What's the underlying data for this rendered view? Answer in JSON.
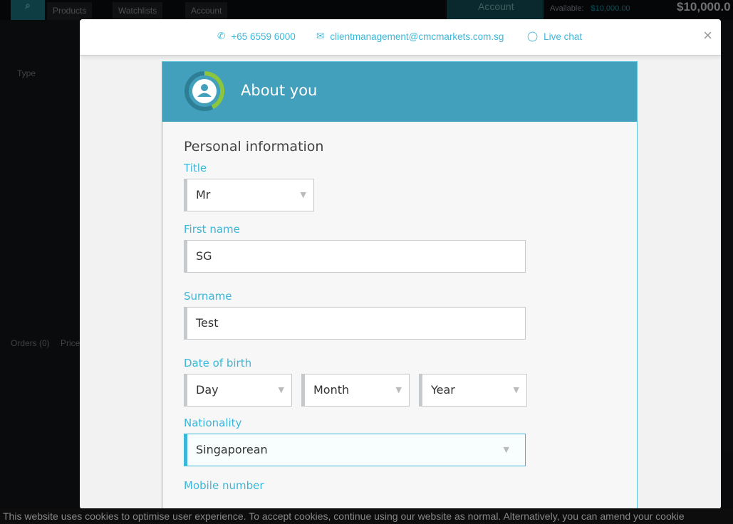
{
  "app": {
    "nav": [
      "Products",
      "Watchlists",
      "Account"
    ],
    "account_label": "Account",
    "available_label": "Available:",
    "available_value": "$10,000.00",
    "balance": "$10,000.0",
    "col_type": "Type",
    "orders_tab": "Orders (0)",
    "prices_tab": "Price"
  },
  "modal": {
    "phone": "+65 6559 6000",
    "email": "clientmanagement@cmcmarkets.com.sg",
    "chat": "Live chat",
    "close": "×"
  },
  "card": {
    "title": "About you",
    "section": "Personal information",
    "title_label": "Title",
    "title_value": "Mr",
    "first_label": "First name",
    "first_value": "SG",
    "surname_label": "Surname",
    "surname_value": "Test",
    "dob_label": "Date of birth",
    "day": "Day",
    "month": "Month",
    "year": "Year",
    "nat_label": "Nationality",
    "nat_value": "Singaporean",
    "mobile_label": "Mobile number"
  },
  "cookie": "This website uses cookies to optimise user experience. To accept cookies, continue using our website as normal. Alternatively, you can amend your cookie",
  "colors": {
    "accent": "#3bb7d9",
    "card_header": "#42a0bd",
    "progress_green": "#8cc63f"
  }
}
